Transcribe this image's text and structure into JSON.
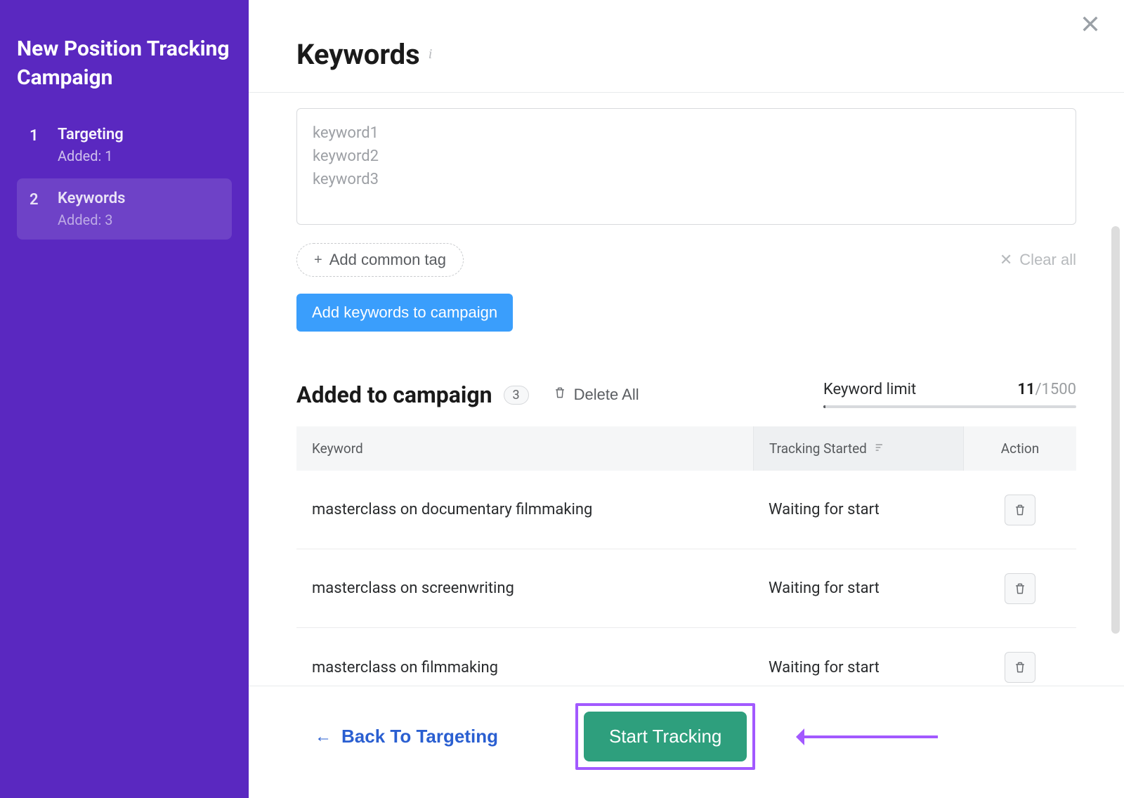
{
  "sidebar": {
    "title": "New Position Tracking Campaign",
    "steps": [
      {
        "num": "1",
        "label": "Targeting",
        "sub": "Added: 1"
      },
      {
        "num": "2",
        "label": "Keywords",
        "sub": "Added: 3"
      }
    ]
  },
  "header": {
    "title": "Keywords"
  },
  "input": {
    "placeholder": "keyword1\nkeyword2\nkeyword3",
    "add_tag": "Add common tag",
    "clear_all": "Clear all",
    "add_btn": "Add keywords to campaign"
  },
  "campaign": {
    "title": "Added to campaign",
    "count": "3",
    "delete_all": "Delete All",
    "limit_label": "Keyword limit",
    "limit_used": "11",
    "limit_total": "/1500"
  },
  "table": {
    "col_keyword": "Keyword",
    "col_tracking": "Tracking Started",
    "col_action": "Action",
    "rows": [
      {
        "kw": "masterclass on documentary filmmaking",
        "status": "Waiting for start"
      },
      {
        "kw": "masterclass on screenwriting",
        "status": "Waiting for start"
      },
      {
        "kw": "masterclass on filmmaking",
        "status": "Waiting for start"
      }
    ]
  },
  "footer": {
    "back": "Back To Targeting",
    "start": "Start Tracking"
  }
}
